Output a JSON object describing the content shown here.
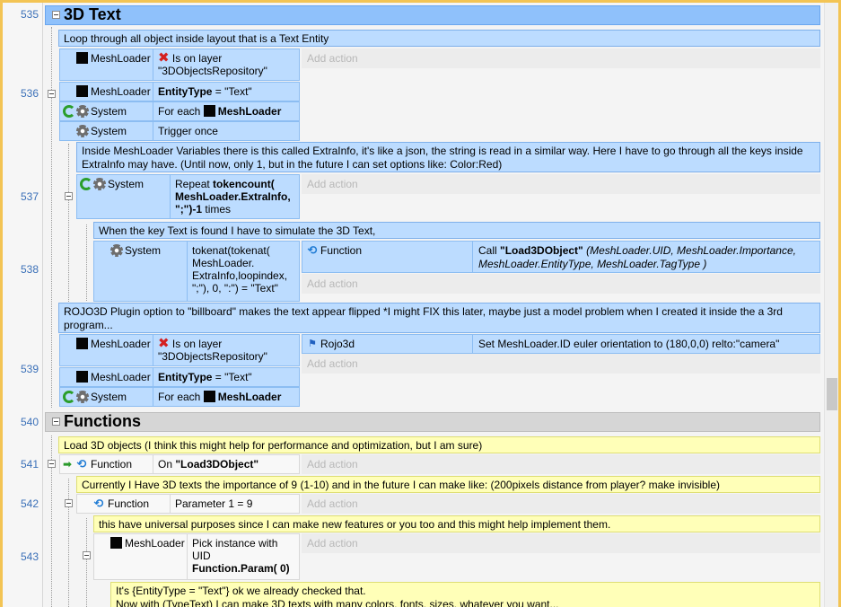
{
  "line_numbers": [
    "535",
    "536",
    "537",
    "538",
    "539",
    "540",
    "541",
    "542",
    "543"
  ],
  "groups": [
    {
      "title": "3D Text",
      "style": "blue"
    },
    {
      "title": "Functions",
      "style": "gray"
    }
  ],
  "comments": [
    "Loop through all object inside layout that is a Text Entity",
    "Inside MeshLoader Variables there is this called ExtraInfo, it's like a json, the string is read in a similar way. Here I have to go through all the keys inside ExtraInfo may have. (Until now, only 1, but in the future I can set options like: Color:Red)",
    "When the key Text is found I have to simulate the 3D Text,",
    "ROJO3D Plugin option to \"billboard\" makes the text appear flipped *I might FIX this later, maybe just a model problem when I created it inside the a 3rd program...",
    "Load 3D objects (I think this might help for performance and optimization, but I am sure)",
    "Currently I Have 3D texts the importance of 9 (1-10) and in the future I can make like: (200pixels distance from player? make invisible)",
    "this have universal purposes since I can make new features or you too and this might help implement them.",
    "It's {EntityType = \"Text\"} ok we already checked that.",
    "Now with (TypeText) I can make 3D texts with many colors, fonts, sizes, whatever you want..."
  ],
  "objects": {
    "meshloader": "MeshLoader",
    "system": "System",
    "function": "Function",
    "rojo3d": "Rojo3d"
  },
  "conditions": {
    "is_on_layer": "Is on layer",
    "layer_name": "\"3DObjectsRepository\"",
    "entity_type_key": "EntityType",
    "entity_type_val": " = \"Text\"",
    "for_each": "For each",
    "trigger_once": "Trigger once",
    "repeat_prefix": "Repeat",
    "repeat_expr": "tokencount( MeshLoader.ExtraInfo, \";\")-1",
    "repeat_suffix": "times",
    "tokenat_expr": "tokenat(tokenat( MeshLoader. ExtraInfo,loopindex, \";\"), 0, \":\") = \"Text\"",
    "on_prefix": "On",
    "on_func": "\"Load3DObject\"",
    "param": "Parameter 1 = 9",
    "pick_prefix": "Pick instance with UID",
    "pick_expr": "Function.Param( 0)"
  },
  "actions": {
    "call_prefix": "Call",
    "call_func": "\"Load3DObject\"",
    "call_args": "(MeshLoader.UID, MeshLoader.Importance, MeshLoader.EntityType, MeshLoader.TagType )",
    "euler": "Set MeshLoader.ID euler orientation to (180,0,0) relto:\"camera\""
  },
  "add_action": "Add action",
  "icons": {
    "gear": "gear-icon",
    "trigger": "green-cycle-icon",
    "function": "blue-cycle-icon",
    "error": "red-x-icon",
    "arrow": "green-arrow-icon",
    "rojo": "rojo3d-icon"
  }
}
